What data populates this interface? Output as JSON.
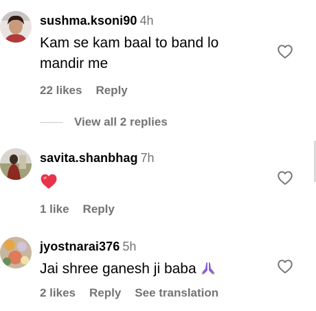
{
  "comments": [
    {
      "username": "sushma.ksoni90",
      "time": "4h",
      "text_line1": "Kam se kam baal to band lo",
      "text_line2": "mandir me",
      "likes": "22 likes",
      "reply": "Reply",
      "view_replies": "View all 2 replies"
    },
    {
      "username": "savita.shanbhag",
      "time": "7h",
      "likes": "1 like",
      "reply": "Reply"
    },
    {
      "username": "jyostnarai376",
      "time": "5h",
      "text": "Jai shree ganesh ji baba",
      "likes": "2 likes",
      "reply": "Reply",
      "see_translation": "See translation"
    }
  ],
  "colors": {
    "muted_text": "#737373",
    "heart_emoji": "#e8344a",
    "pray_emoji": "#8a63d2"
  },
  "icons": [
    "heart-outline-icon",
    "red-heart-emoji",
    "folded-hands-emoji"
  ]
}
